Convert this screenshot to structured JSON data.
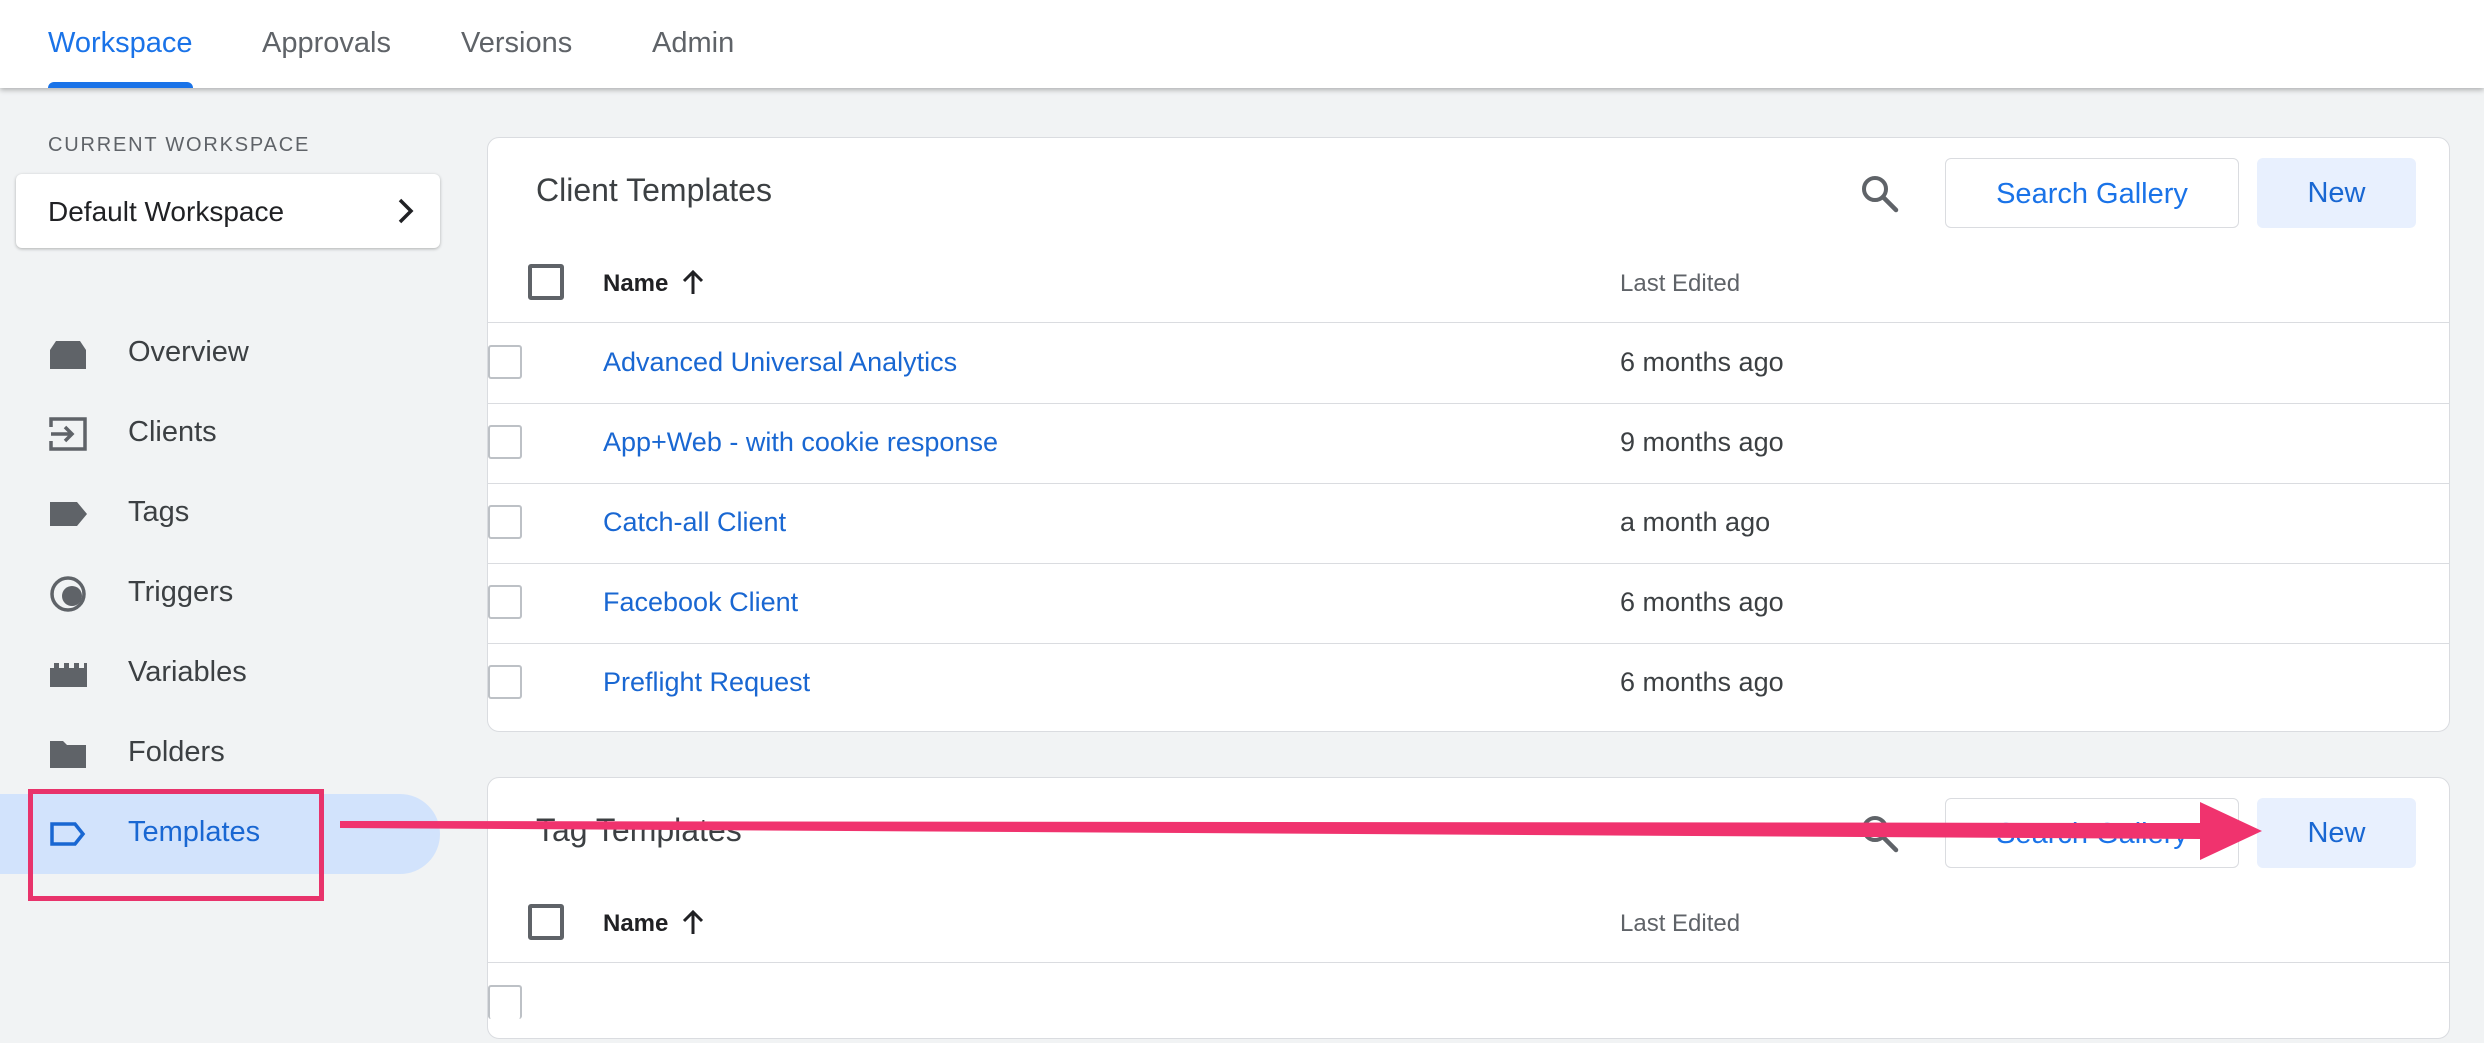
{
  "topnav": {
    "tabs": [
      {
        "label": "Workspace",
        "active": true
      },
      {
        "label": "Approvals",
        "active": false
      },
      {
        "label": "Versions",
        "active": false
      },
      {
        "label": "Admin",
        "active": false
      }
    ]
  },
  "sidebar": {
    "workspace_label": "CURRENT WORKSPACE",
    "workspace_name": "Default Workspace",
    "items": [
      {
        "label": "Overview",
        "icon": "overview-icon"
      },
      {
        "label": "Clients",
        "icon": "clients-icon"
      },
      {
        "label": "Tags",
        "icon": "tag-icon"
      },
      {
        "label": "Triggers",
        "icon": "trigger-icon"
      },
      {
        "label": "Variables",
        "icon": "variables-icon"
      },
      {
        "label": "Folders",
        "icon": "folder-icon"
      },
      {
        "label": "Templates",
        "icon": "template-icon",
        "active": true
      }
    ]
  },
  "client_templates": {
    "title": "Client Templates",
    "search_gallery_label": "Search Gallery",
    "new_label": "New",
    "columns": {
      "name": "Name",
      "last_edited": "Last Edited"
    },
    "rows": [
      {
        "name": "Advanced Universal Analytics",
        "last_edited": "6 months ago"
      },
      {
        "name": "App+Web - with cookie response",
        "last_edited": "9 months ago"
      },
      {
        "name": "Catch-all Client",
        "last_edited": "a month ago"
      },
      {
        "name": "Facebook Client",
        "last_edited": "6 months ago"
      },
      {
        "name": "Preflight Request",
        "last_edited": "6 months ago"
      }
    ]
  },
  "tag_templates": {
    "title": "Tag Templates",
    "search_gallery_label": "Search Gallery",
    "new_label": "New",
    "columns": {
      "name": "Name",
      "last_edited": "Last Edited"
    }
  },
  "colors": {
    "accent": "#1a73e8",
    "annotation": "#e8336b"
  }
}
